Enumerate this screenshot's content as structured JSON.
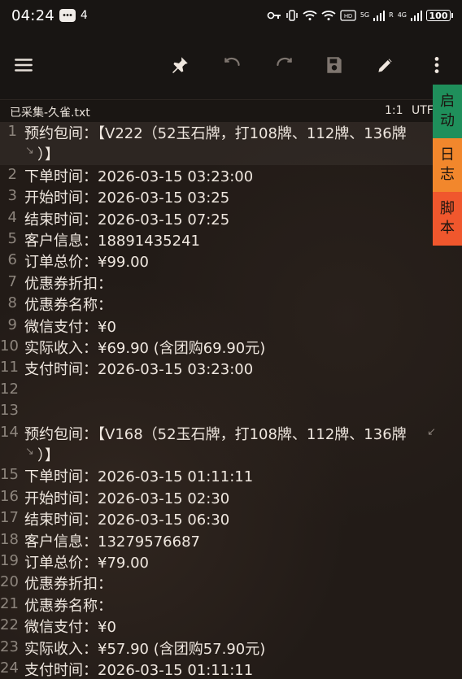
{
  "status_bar": {
    "time": "04:24",
    "notification_count": "4",
    "network_left": "5G",
    "network_right": "4G",
    "roaming": "R",
    "battery": "100"
  },
  "file_bar": {
    "file_name": "已采集-久雀.txt",
    "cursor_position": "1:1",
    "encoding": "UTF"
  },
  "side_buttons": [
    {
      "label": "启动",
      "color": "#1f8f5b"
    },
    {
      "label": "日志",
      "color": "#f2872c"
    },
    {
      "label": "脚本",
      "color": "#f0572d"
    }
  ],
  "editor": {
    "lines": [
      {
        "num": "1",
        "text": "预约包间：【V222（52玉石牌，打108牌、112牌、136牌"
      },
      {
        "num": "",
        "text": "）】"
      },
      {
        "num": "2",
        "text": "下单时间：2026-03-15 03:23:00"
      },
      {
        "num": "3",
        "text": "开始时间：2026-03-15 03:25"
      },
      {
        "num": "4",
        "text": "结束时间：2026-03-15 07:25"
      },
      {
        "num": "5",
        "text": "客户信息：18891435241"
      },
      {
        "num": "6",
        "text": "订单总价：¥99.00"
      },
      {
        "num": "7",
        "text": "优惠券折扣："
      },
      {
        "num": "8",
        "text": "优惠券名称："
      },
      {
        "num": "9",
        "text": "微信支付：¥0"
      },
      {
        "num": "10",
        "text": "实际收入：¥69.90 (含团购69.90元)"
      },
      {
        "num": "11",
        "text": "支付时间：2026-03-15 03:23:00"
      },
      {
        "num": "12",
        "text": ""
      },
      {
        "num": "13",
        "text": ""
      },
      {
        "num": "14",
        "text": "预约包间：【V168（52玉石牌，打108牌、112牌、136牌"
      },
      {
        "num": "",
        "text": "）】"
      },
      {
        "num": "15",
        "text": "下单时间：2026-03-15 01:11:11"
      },
      {
        "num": "16",
        "text": "开始时间：2026-03-15 02:30"
      },
      {
        "num": "17",
        "text": "结束时间：2026-03-15 06:30"
      },
      {
        "num": "18",
        "text": "客户信息：13279576687"
      },
      {
        "num": "19",
        "text": "订单总价：¥79.00"
      },
      {
        "num": "20",
        "text": "优惠券折扣："
      },
      {
        "num": "21",
        "text": "优惠券名称："
      },
      {
        "num": "22",
        "text": "微信支付：¥0"
      },
      {
        "num": "23",
        "text": "实际收入：¥57.90 (含团购57.90元)"
      },
      {
        "num": "24",
        "text": "支付时间：2026-03-15 01:11:11"
      }
    ]
  }
}
